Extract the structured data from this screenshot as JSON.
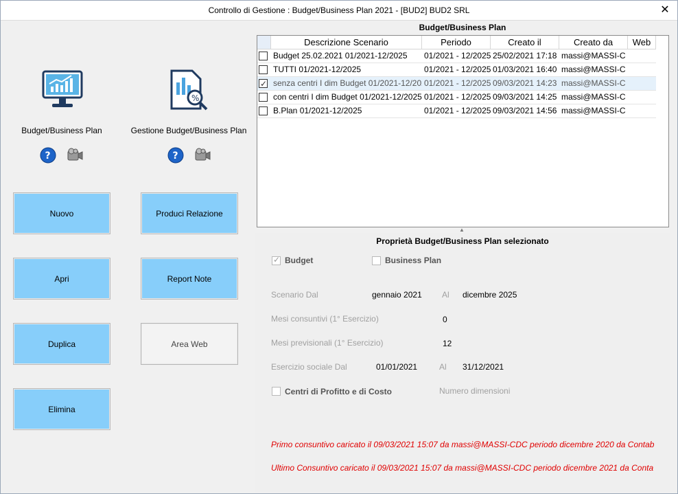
{
  "window": {
    "title": "Controllo di Gestione : Budget/Business Plan 2021 - [BUD2] BUD2 SRL",
    "close_glyph": "✕"
  },
  "left": {
    "tile_budget": {
      "label": "Budget/Business Plan",
      "icon": "monitor-chart-icon"
    },
    "tile_gestione": {
      "label": "Gestione Budget/Business Plan",
      "icon": "report-search-icon"
    },
    "help_icon": "help-icon",
    "camera_icon": "video-camera-icon",
    "buttons": {
      "nuovo": "Nuovo",
      "produci": "Produci Relazione",
      "apri": "Apri",
      "report_note": "Report Note",
      "duplica": "Duplica",
      "area_web": "Area Web",
      "elimina": "Elimina"
    }
  },
  "grid": {
    "caption": "Budget/Business Plan",
    "columns": [
      "Descrizione Scenario",
      "Periodo",
      "Creato il",
      "Creato da",
      "Web"
    ],
    "rows": [
      {
        "checked": false,
        "selected": false,
        "descr": "Budget 25.02.2021 01/2021-12/2025",
        "periodo": "01/2021 - 12/2025",
        "creato_il": "25/02/2021 17:18",
        "creato_da": "massi@MASSI-C"
      },
      {
        "checked": false,
        "selected": false,
        "descr": "TUTTI 01/2021-12/2025",
        "periodo": "01/2021 - 12/2025",
        "creato_il": "01/03/2021 16:40",
        "creato_da": "massi@MASSI-C"
      },
      {
        "checked": true,
        "selected": true,
        "descr": "senza centri I dim Budget 01/2021-12/202",
        "periodo": "01/2021 - 12/2025",
        "creato_il": "09/03/2021 14:23",
        "creato_da": "massi@MASSI-C"
      },
      {
        "checked": false,
        "selected": false,
        "descr": "con centri I dim Budget 01/2021-12/2025",
        "periodo": "01/2021 - 12/2025",
        "creato_il": "09/03/2021 14:25",
        "creato_da": "massi@MASSI-C"
      },
      {
        "checked": false,
        "selected": false,
        "descr": "B.Plan 01/2021-12/2025",
        "periodo": "01/2021 - 12/2025",
        "creato_il": "09/03/2021 14:56",
        "creato_da": "massi@MASSI-C"
      }
    ]
  },
  "props": {
    "caption": "Proprietà Budget/Business Plan selezionato",
    "budget_label": "Budget",
    "business_plan_label": "Business Plan",
    "scenario_dal_label": "Scenario Dal",
    "scenario_dal_value": "gennaio 2021",
    "al_label": "Al",
    "scenario_al_value": "dicembre 2025",
    "mesi_consuntivi_label": "Mesi consuntivi (1° Esercizio)",
    "mesi_consuntivi_value": "0",
    "mesi_previsionali_label": "Mesi previsionali (1° Esercizio)",
    "mesi_previsionali_value": "12",
    "esercizio_dal_label": "Esercizio sociale Dal",
    "esercizio_dal_value": "01/01/2021",
    "esercizio_al_value": "31/12/2021",
    "centri_label": "Centri di Profitto e di Costo",
    "numero_dimensioni_label": "Numero dimensioni",
    "primo_consuntivo": "Primo consuntivo caricato il 09/03/2021 15:07 da massi@MASSI-CDC periodo dicembre 2020 da Contab",
    "ultimo_consuntivo": "Ultimo Consuntivo caricato il 09/03/2021 15:07 da massi@MASSI-CDC periodo dicembre 2021 da Conta"
  },
  "colors": {
    "button_blue": "#87cefa",
    "selection": "#e5f1fb",
    "error_red": "#e00000"
  }
}
